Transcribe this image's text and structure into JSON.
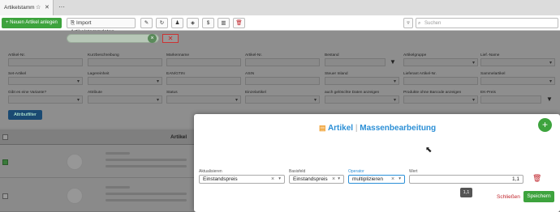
{
  "tabs": {
    "active_title": "Artikelstamm",
    "more": "···"
  },
  "toolbar": {
    "new_article": "+ Neuen Artikel anlegen",
    "import": "Import Artikelstammdaten",
    "search_placeholder": "Suchen"
  },
  "filters": {
    "row1": [
      "Artikel-Nr.",
      "Kurzbeschreibung",
      "Markenname",
      "Artikel-Nr.",
      "Bestand",
      "Artikelgruppe",
      "Lief.-Name"
    ],
    "row2": [
      "Set-Artikel",
      "Lagereinheit",
      "EAN/GTIN",
      "ASIN",
      "Steuer Inland",
      "Lieferant Artikel-Nr.",
      "Sammelartikel"
    ],
    "row3": [
      "Gibt es eine Variante?",
      "Attribute",
      "Status",
      "Einzelartikel",
      "auch gelöschte Daten anzeigen",
      "Produkte ohne Barcode anzeigen",
      "EK-Preis"
    ],
    "attribute_filter_button": "Attributfilter"
  },
  "grid": {
    "header": "Artikel"
  },
  "modal": {
    "title_prefix": "Artikel",
    "separator": "|",
    "title": "Massenbearbeitung",
    "fields": {
      "aktualisieren_label": "Aktualisieren",
      "aktualisieren_value": "Einstandspreis",
      "basisfeld_label": "Basisfeld",
      "basisfeld_value": "Einstandspreis",
      "operator_label": "Operator",
      "operator_value": "multiplizieren",
      "wert_label": "Wert",
      "wert_value": "1,1"
    },
    "tooltip": "1,1",
    "close_label": "Schließen",
    "save_label": "Speichern"
  },
  "colors": {
    "accent_green": "#3da33d",
    "title_blue": "#2b8fd6",
    "danger_red": "#c0262d",
    "icon_orange": "#f0a030"
  }
}
